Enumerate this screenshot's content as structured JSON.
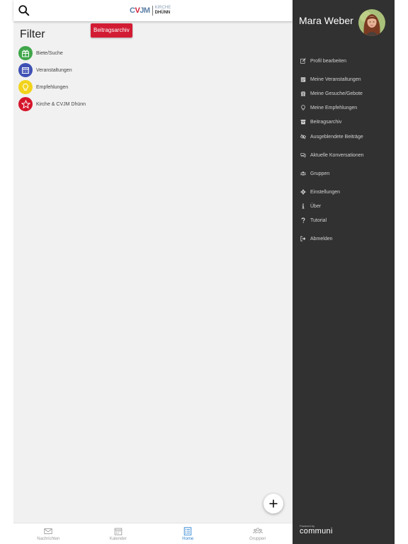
{
  "topbar": {
    "search_icon": "search-icon",
    "logo": {
      "mark": "CVJM",
      "line1": "KIRCHE",
      "line2": "DHÜNN"
    }
  },
  "archive_tag": "Beitragsarchiv",
  "filter": {
    "title": "Filter",
    "items": [
      {
        "label": "Biete/Suche",
        "icon": "gift-icon",
        "color": "#3fa64a"
      },
      {
        "label": "Veranstaltungen",
        "icon": "calendar-icon",
        "color": "#3f51b5"
      },
      {
        "label": "Empfehlungen",
        "icon": "lightbulb-icon",
        "color": "#f2d31b"
      },
      {
        "label": "Kirche & CVJM Dhünn",
        "icon": "star-icon",
        "color": "#d5152b"
      }
    ]
  },
  "fab": {
    "icon": "plus-icon"
  },
  "bottom_tabs": [
    {
      "label": "Nachrichten",
      "icon": "envelope-icon",
      "active": false
    },
    {
      "label": "Kalender",
      "icon": "calendar-icon",
      "active": false
    },
    {
      "label": "Home",
      "icon": "list-icon",
      "active": true
    },
    {
      "label": "Gruppen",
      "icon": "group-icon",
      "active": false
    }
  ],
  "drawer": {
    "user_name": "Mara Weber",
    "menu": [
      {
        "label": "Profil bearbeiten",
        "icon": "edit-icon"
      },
      {
        "label": "Meine Veranstaltungen",
        "icon": "calendar-icon"
      },
      {
        "label": "Meine Gesuche/Gebote",
        "icon": "gift-icon"
      },
      {
        "label": "Meine Empfehlungen",
        "icon": "lightbulb-icon"
      },
      {
        "label": "Beitragsarchiv",
        "icon": "archive-icon"
      },
      {
        "label": "Ausgeblendete Beiträge",
        "icon": "eye-slash-icon"
      },
      {
        "label": "Aktuelle Konversationen",
        "icon": "comments-icon"
      },
      {
        "label": "Gruppen",
        "icon": "users-icon"
      },
      {
        "label": "Einstellungen",
        "icon": "gear-icon"
      },
      {
        "label": "Über",
        "icon": "info-icon"
      },
      {
        "label": "Tutorial",
        "icon": "question-icon"
      },
      {
        "label": "Abmelden",
        "icon": "sign-out-icon"
      }
    ],
    "brand_small": "Powered by",
    "brand_big": "communi"
  },
  "colors": {
    "accent_red": "#d21c33",
    "drawer_bg": "#313131",
    "active_tab": "#2f86d3"
  }
}
